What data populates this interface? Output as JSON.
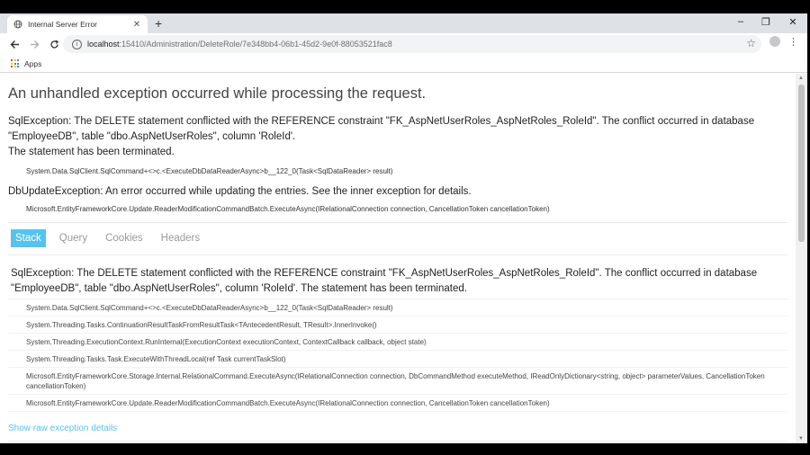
{
  "tab": {
    "title": "Internal Server Error",
    "close": "✕",
    "new": "+"
  },
  "window": {
    "minimize": "–",
    "maximize": "❐",
    "close": "✕"
  },
  "address": {
    "host": "localhost",
    "path": ":15410/Administration/DeleteRole/7e348bb4-06b1-45d2-9e0f-88053521fac8"
  },
  "bookmarks": {
    "apps": "Apps"
  },
  "page": {
    "heading": "An unhandled exception occurred while processing the request.",
    "error1_line1": "SqlException: The DELETE statement conflicted with the REFERENCE constraint \"FK_AspNetUserRoles_AspNetRoles_RoleId\". The conflict occurred in database \"EmployeeDB\", table \"dbo.AspNetUserRoles\", column 'RoleId'.",
    "error1_line2": "The statement has been terminated.",
    "error1_location": "System.Data.SqlClient.SqlCommand+<>c.<ExecuteDbDataReaderAsync>b__122_0(Task<SqlDataReader> result)",
    "error2": "DbUpdateException: An error occurred while updating the entries. See the inner exception for details.",
    "error2_location": "Microsoft.EntityFrameworkCore.Update.ReaderModificationCommandBatch.ExecuteAsync(IRelationalConnection connection, CancellationToken cancellationToken)",
    "tabs": [
      "Stack",
      "Query",
      "Cookies",
      "Headers"
    ],
    "stack_message": "SqlException: The DELETE statement conflicted with the REFERENCE constraint \"FK_AspNetUserRoles_AspNetRoles_RoleId\". The conflict occurred in database \"EmployeeDB\", table \"dbo.AspNetUserRoles\", column 'RoleId'. The statement has been terminated.",
    "frames": [
      "System.Data.SqlClient.SqlCommand+<>c.<ExecuteDbDataReaderAsync>b__122_0(Task<SqlDataReader> result)",
      "System.Threading.Tasks.ContinuationResultTaskFromResultTask<TAntecedentResult, TResult>.InnerInvoke()",
      "System.Threading.ExecutionContext.RunInternal(ExecutionContext executionContext, ContextCallback callback, object state)",
      "System.Threading.Tasks.Task.ExecuteWithThreadLocal(ref Task currentTaskSlot)",
      "Microsoft.EntityFrameworkCore.Storage.Internal.RelationalCommand.ExecuteAsync(IRelationalConnection connection, DbCommandMethod executeMethod, IReadOnlyDictionary<string, object> parameterValues, CancellationToken cancellationToken)",
      "Microsoft.EntityFrameworkCore.Update.ReaderModificationCommandBatch.ExecuteAsync(IRelationalConnection connection, CancellationToken cancellationToken)"
    ],
    "raw_link": "Show raw exception details"
  }
}
